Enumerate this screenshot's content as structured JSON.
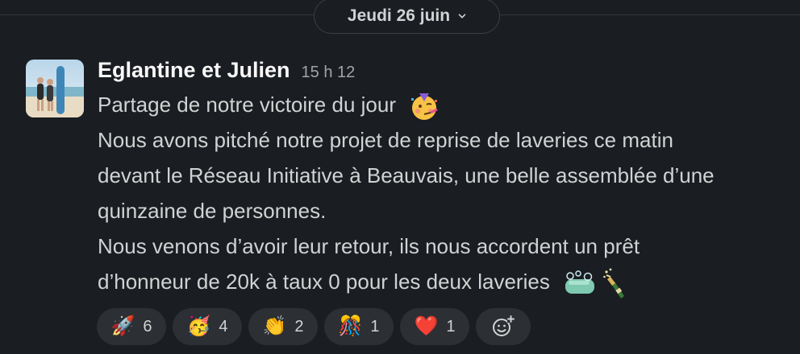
{
  "date_divider": {
    "label": "Jeudi 26 juin"
  },
  "message": {
    "author": "Eglantine et Julien",
    "time": "15 h 12",
    "lines": [
      "Partage de notre victoire du jour",
      "Nous avons pitché notre projet de reprise de laveries ce matin",
      "devant le Réseau Initiative à Beauvais, une belle assemblée d’une",
      "quinzaine de personnes.",
      "Nous venons d’avoir leur retour, ils nous accordent un prêt",
      "d’honneur de 20k à taux 0 pour les deux laveries"
    ],
    "inline_emojis": [
      "partying-face",
      "soap",
      "champagne"
    ]
  },
  "reactions": [
    {
      "emoji": "🚀",
      "count": "6"
    },
    {
      "emoji": "🥳",
      "count": "4"
    },
    {
      "emoji": "👏",
      "count": "2"
    },
    {
      "emoji": "🎊",
      "count": "1"
    },
    {
      "emoji": "❤️",
      "count": "1"
    }
  ],
  "add_reaction_icon": "add-emoji-icon"
}
